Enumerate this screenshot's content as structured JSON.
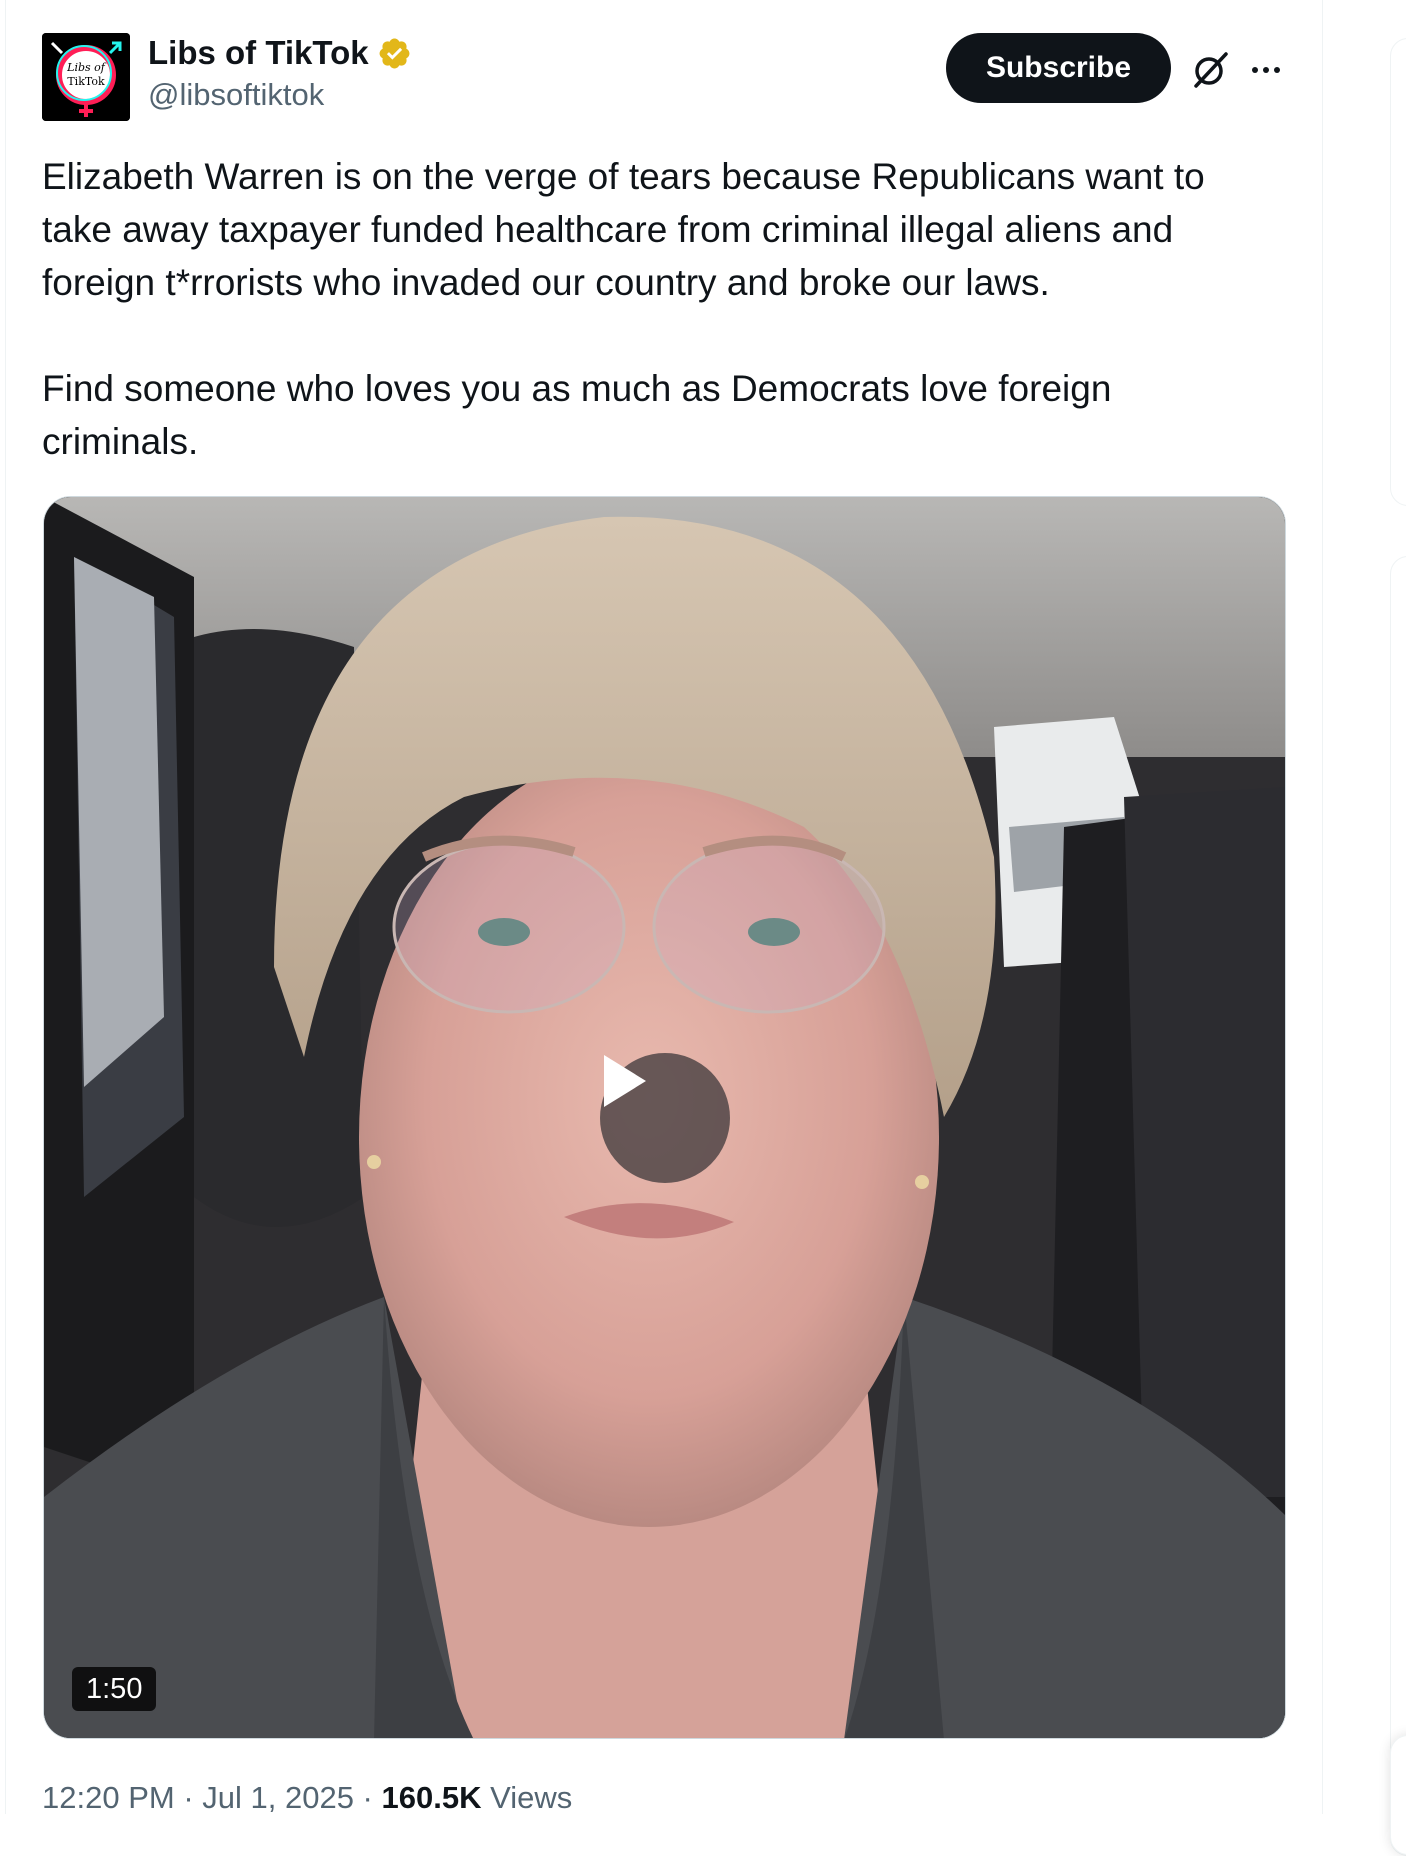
{
  "author": {
    "display_name": "Libs of TikTok",
    "handle": "@libsoftiktok",
    "avatar_text_line1": "Libs of",
    "avatar_text_line2": "TikTok",
    "verified_color": "#e2b719"
  },
  "actions": {
    "subscribe_label": "Subscribe"
  },
  "tweet": {
    "text": "Elizabeth Warren is on the verge of tears because Republicans want to\ntake away taxpayer funded healthcare from criminal illegal aliens and\nforeign t*rrorists who invaded our country and broke our laws.\n\nFind someone who loves you as much as Democrats love foreign\ncriminals."
  },
  "media": {
    "type": "video",
    "duration": "1:50"
  },
  "meta": {
    "time": "12:20 PM",
    "separator": " · ",
    "date": "Jul 1, 2025",
    "views_count": "160.5K",
    "views_label": "Views"
  },
  "colors": {
    "primary_text": "#0f1419",
    "secondary_text": "#536471",
    "button_bg": "#0f1419"
  },
  "icons": {
    "verified": "verified-badge-icon",
    "grok": "grok-icon",
    "more": "more-options-icon",
    "play": "play-icon"
  }
}
